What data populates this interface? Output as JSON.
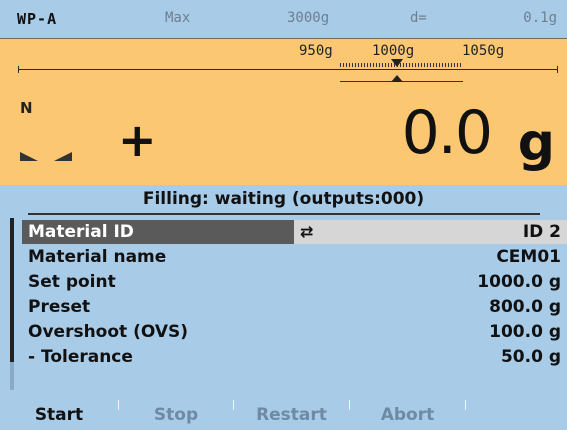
{
  "topbar": {
    "model": "WP-A",
    "max_label": "Max",
    "max_value": "3000g",
    "d_label": "d=",
    "d_value": "0.1g"
  },
  "display": {
    "ticks": [
      "950g",
      "1000g",
      "1050g"
    ],
    "net_indicator": "N",
    "sign": "+",
    "weight": "0.0",
    "unit": "g"
  },
  "status": "Filling: waiting (outputs:000)",
  "params": [
    {
      "label": "Material ID",
      "value": "ID 2"
    },
    {
      "label": "Material name",
      "value": "CEM01"
    },
    {
      "label": "Set point",
      "value": "1000.0 g"
    },
    {
      "label": "Preset",
      "value": "800.0 g"
    },
    {
      "label": "Overshoot (OVS)",
      "value": "100.0 g"
    },
    {
      "label": "- Tolerance",
      "value": "50.0 g"
    }
  ],
  "softkeys": [
    {
      "label": "Start",
      "state": "active"
    },
    {
      "label": "Stop",
      "state": "inactive"
    },
    {
      "label": "Restart",
      "state": "inactive"
    },
    {
      "label": "Abort",
      "state": "inactive"
    },
    {
      "label": "",
      "state": "inactive"
    }
  ],
  "icons": {
    "swap": "swap-arrows-icon"
  },
  "colors": {
    "background": "#a8cbe8",
    "display": "#fbc772",
    "selected_row": "#5a5a5a"
  }
}
